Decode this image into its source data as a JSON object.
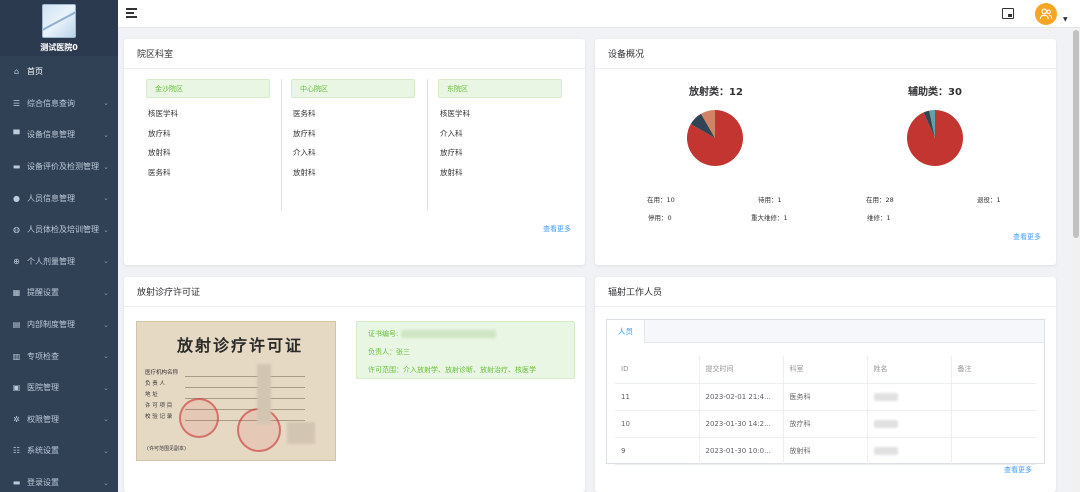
{
  "brand": {
    "name": "测试医院0"
  },
  "sidebar": {
    "items": [
      {
        "label": "首页",
        "icon": "home-icon",
        "glyph": "⌂",
        "has_children": false
      },
      {
        "label": "综合信息查询",
        "icon": "list-icon",
        "glyph": "☰",
        "has_children": true
      },
      {
        "label": "设备信息管理",
        "icon": "monitor-icon",
        "glyph": "▀",
        "has_children": true
      },
      {
        "label": "设备评价及检测管理",
        "icon": "chat-icon",
        "glyph": "▬",
        "has_children": true
      },
      {
        "label": "人员信息管理",
        "icon": "user-icon",
        "glyph": "●",
        "has_children": true
      },
      {
        "label": "人员体检及培训管理",
        "icon": "globe-icon",
        "glyph": "◍",
        "has_children": true
      },
      {
        "label": "个人剂量管理",
        "icon": "plus-circle-icon",
        "glyph": "⊕",
        "has_children": true
      },
      {
        "label": "提醒设置",
        "icon": "calendar-icon",
        "glyph": "▦",
        "has_children": true
      },
      {
        "label": "内部制度管理",
        "icon": "folder-icon",
        "glyph": "▤",
        "has_children": true
      },
      {
        "label": "专项检查",
        "icon": "document-icon",
        "glyph": "▥",
        "has_children": true
      },
      {
        "label": "医院管理",
        "icon": "building-icon",
        "glyph": "▣",
        "has_children": true
      },
      {
        "label": "权限管理",
        "icon": "gear-icon",
        "glyph": "✲",
        "has_children": true
      },
      {
        "label": "系统设置",
        "icon": "sliders-icon",
        "glyph": "☷",
        "has_children": true
      },
      {
        "label": "登录设置",
        "icon": "message-icon",
        "glyph": "▬",
        "has_children": true
      }
    ]
  },
  "departments": {
    "title": "院区科室",
    "more": "查看更多",
    "columns": [
      {
        "campus": "金沙院区",
        "items": [
          "核医学科",
          "放疗科",
          "放射科",
          "医务科"
        ]
      },
      {
        "campus": "中心院区",
        "items": [
          "医务科",
          "放疗科",
          "介入科",
          "放射科"
        ]
      },
      {
        "campus": "东院区",
        "items": [
          "核医学科",
          "介入科",
          "放疗科",
          "放射科"
        ]
      }
    ]
  },
  "devices": {
    "title": "设备概况",
    "more": "查看更多",
    "groups": [
      {
        "title": "放射类：12",
        "stats": [
          "在用：10",
          "待用：1",
          "停用：0",
          "重大维修：1"
        ],
        "slices": [
          {
            "label": "在用",
            "value": 10,
            "color": "#c23531"
          },
          {
            "label": "停用",
            "value": 0,
            "color": "#2f4554"
          },
          {
            "label": "重大维修",
            "value": 1,
            "color": "#2f4554"
          },
          {
            "label": "待用",
            "value": 1,
            "color": "#d48265"
          }
        ]
      },
      {
        "title": "辅助类：30",
        "stats": [
          "在用：28",
          "退役：1",
          "维修：1"
        ],
        "slices": [
          {
            "label": "在用",
            "value": 28,
            "color": "#c23531"
          },
          {
            "label": "维修",
            "value": 1,
            "color": "#2f4554"
          },
          {
            "label": "退役",
            "value": 1,
            "color": "#61a0a8"
          }
        ]
      }
    ]
  },
  "license": {
    "title": "放射诊疗许可证",
    "image_title": "放射诊疗许可证",
    "image_labels": [
      "医疗机构名称",
      "负 责 人",
      "地 址",
      "许 可 项 目",
      "校 验 记 录"
    ],
    "image_footer": "(许可范围见副本)",
    "number_label": "证书编号:",
    "owner": "负责人：张三",
    "scope": "许可范围：介入放射学、放射诊断、放射治疗、核医学"
  },
  "staff": {
    "title": "辐射工作人员",
    "tab": "人员",
    "more": "查看更多",
    "headers": [
      "ID",
      "提交时间",
      "科室",
      "姓名",
      "备注"
    ],
    "rows": [
      {
        "id": "11",
        "time": "2023-02-01 21:4...",
        "dept": "医务科"
      },
      {
        "id": "10",
        "time": "2023-01-30 14:2...",
        "dept": "放疗科"
      },
      {
        "id": "9",
        "time": "2023-01-30 10:0...",
        "dept": "放射科"
      }
    ]
  },
  "colors": {
    "sidebar": "#304156",
    "accent": "#409eff",
    "green": "#67c23a",
    "avatar": "#f5a623"
  }
}
